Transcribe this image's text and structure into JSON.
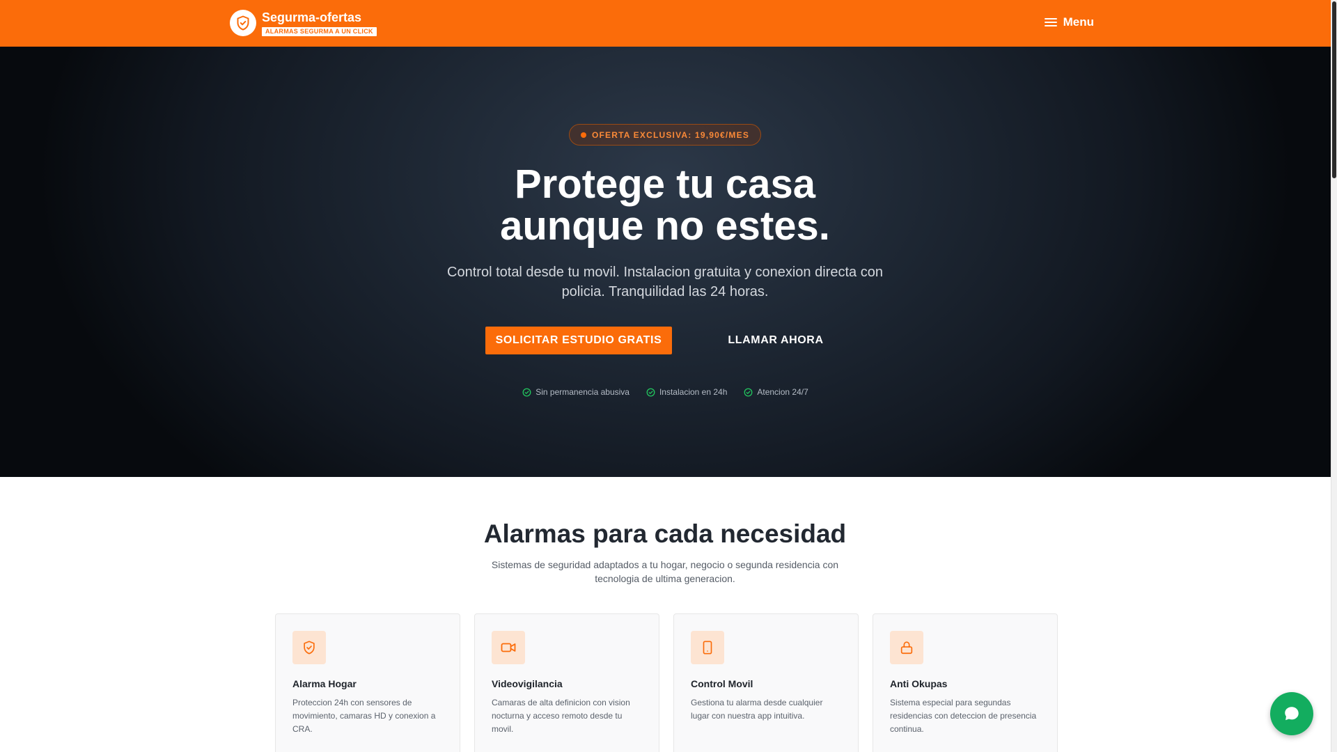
{
  "header": {
    "brand_name": "Segurma-ofertas",
    "brand_tag": "ALARMAS SEGURMA A UN CLICK",
    "menu_label": "Menu",
    "bg_color": "#fb6c0a"
  },
  "hero": {
    "badge": "OFERTA EXCLUSIVA: 19,90€/MES",
    "title_line1": "Protege tu casa",
    "title_line2": "aunque no estes.",
    "subtitle": "Control total desde tu movil. Instalacion gratuita y conexion directa con policia. Tranquilidad las 24 horas.",
    "cta_primary": "SOLICITAR ESTUDIO GRATIS",
    "cta_secondary": "LLAMAR AHORA",
    "perks": [
      "Sin permanencia abusiva",
      "Instalacion en 24h",
      "Atencion 24/7"
    ]
  },
  "services": {
    "title": "Alarmas para cada necesidad",
    "subtitle": "Sistemas de seguridad adaptados a tu hogar, negocio o segunda residencia con tecnologia de ultima generacion.",
    "cards": [
      {
        "icon": "shield-check-icon",
        "title": "Alarma Hogar",
        "desc": "Proteccion 24h con sensores de movimiento, camaras HD y conexion a CRA."
      },
      {
        "icon": "video-camera-icon",
        "title": "Videovigilancia",
        "desc": "Camaras de alta definicion con vision nocturna y acceso remoto desde tu movil."
      },
      {
        "icon": "smartphone-icon",
        "title": "Control Movil",
        "desc": "Gestiona tu alarma desde cualquier lugar con nuestra app intuitiva."
      },
      {
        "icon": "lock-icon",
        "title": "Anti Okupas",
        "desc": "Sistema especial para segundas residencias con deteccion de presencia continua."
      }
    ]
  },
  "chat": {
    "icon": "chat-bubble-icon",
    "color": "#13ad5f"
  },
  "colors": {
    "accent": "#fb6c0a",
    "success": "#22c55e",
    "hero_bg": "#1c2531"
  }
}
